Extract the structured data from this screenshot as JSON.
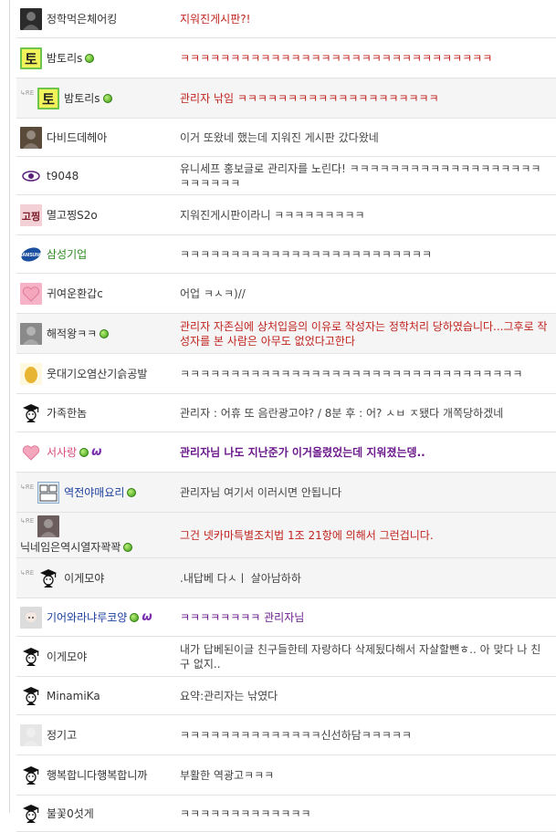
{
  "comments": [
    {
      "nick": "정학먹은체어킹",
      "text": "지워진게시판?!",
      "style": "red",
      "avatar": "photo-icon",
      "avatar_color": "#2b2b2b"
    },
    {
      "nick": "밤토리s",
      "text": "ㅋㅋㅋㅋㅋㅋㅋㅋㅋㅋㅋㅋㅋㅋㅋㅋㅋㅋㅋㅋㅋㅋㅋㅋㅋㅋㅋㅋㅋㅋㅋ",
      "style": "red",
      "avatar": "to-character-icon",
      "avatar_text": "토",
      "avatar_color": "#6fc44b",
      "online": true
    },
    {
      "nick": "밤토리s",
      "text": "관리자 낚임 ㅋㅋㅋㅋㅋㅋㅋㅋㅋㅋㅋㅋㅋㅋㅋㅋㅋㅋㅋㅋ",
      "style": "red",
      "avatar": "to-character-icon",
      "avatar_text": "토",
      "avatar_color": "#6fc44b",
      "online": true,
      "reply": true
    },
    {
      "nick": "다비드데헤아",
      "text": "이거 또왔네 했는데 지워진 게시판 갔다왔네",
      "style": "gray",
      "avatar": "photo-icon",
      "avatar_color": "#5a4a3a"
    },
    {
      "nick": "t9048",
      "text": "유니세프 홍보글로 관리자를 노린다! ㅋㅋㅋㅋㅋㅋㅋㅋㅋㅋㅋㅋㅋㅋㅋㅋㅋㅋㅋㅋㅋㅋㅋㅋㅋ",
      "style": "gray",
      "avatar": "eye-icon",
      "avatar_color": "#ffffff"
    },
    {
      "nick": "멸고찡S2o",
      "text": "지워진게시판이라니 ㅋㅋㅋㅋㅋㅋㅋㅋㅋ",
      "style": "gray",
      "avatar": "text-logo-icon",
      "avatar_text": "고찡",
      "avatar_color": "#7a1c2a"
    },
    {
      "nick": "삼성기업",
      "text": "ㅋㅋㅋㅋㅋㅋㅋㅋㅋㅋㅋㅋㅋㅋㅋㅋㅋㅋㅋㅋㅋㅋㅋㅋㅋ",
      "style": "gray",
      "avatar": "samsung-logo-icon",
      "avatar_color": "#1b4fa0",
      "name_color": "green"
    },
    {
      "nick": "귀여운환갑c",
      "text": "어업 ㅋㅅㅋ)//",
      "style": "gray",
      "avatar": "heart-icon",
      "avatar_color": "#f6b3c8"
    },
    {
      "nick": "해적왕ㅋㅋ",
      "text": "관리자 자존심에 상처입음의 이유로 작성자는 정학처리 당하였습니다...그후로 작성자를 본 사람은 아무도 없었다고한다",
      "style": "red",
      "avatar": "photo-icon",
      "avatar_color": "#8a8a8a",
      "online": true
    },
    {
      "nick": "웃대기오염산기슭공발",
      "text": "ㅋㅋㅋㅋㅋㅋㅋㅋㅋㅋㅋㅋㅋㅋㅋㅋㅋㅋㅋㅋㅋㅋㅋㅋㅋㅋㅋㅋㅋㅋㅋㅋㅋㅋ",
      "style": "gray",
      "avatar": "egg-icon",
      "avatar_color": "#e8b532"
    },
    {
      "nick": "가족한놈",
      "text": "관리자 : 어휴 또 음란광고야? / 8분 후 : 어? ㅅㅂ ㅈ됐다 개쪽당하겠네",
      "style": "gray",
      "avatar": "graduate-icon",
      "avatar_color": "#ffffff"
    },
    {
      "nick": "서사랑",
      "text": "관리자님 나도 지난준가 이거올렸었는데 지워졌는뎅..",
      "style": "purple",
      "avatar": "heart-icon",
      "avatar_color": "#ffffff",
      "online": true,
      "w_badge": "ω",
      "name_color": "pink"
    },
    {
      "nick": "역전야매요리",
      "text": "관리자님 여기서 이러시면 안됩니다",
      "style": "gray",
      "avatar": "comic-icon",
      "avatar_color": "#dfe9f3",
      "online": true,
      "reply": true,
      "name_color": "blue"
    },
    {
      "nick": "닉네임은역시열자꽉꽉",
      "text": "그건 넷카마특별조치법 1조 21항에 의해서 그런겁니다.",
      "style": "red",
      "avatar": "photo-icon",
      "avatar_color": "#6b5d5d",
      "online": true,
      "reply": true,
      "stacked": true
    },
    {
      "nick": "이게모야",
      "text": ".내답베 다ㅅㅣ 살아남하하",
      "style": "gray",
      "avatar": "graduate-icon",
      "avatar_color": "#ffffff",
      "reply": true
    },
    {
      "nick": "기어와라냐루코양",
      "text": "ㅋㅋㅋㅋㅋㅋㅋㅋ 관리자님",
      "style": "purple-plain",
      "avatar": "anime-icon",
      "avatar_color": "#dcdcdc",
      "online": true,
      "w_badge": "ω",
      "name_color": "blue"
    },
    {
      "nick": "이게모야",
      "text": "내가 답베된이글 친구들한테 자랑하다 삭제됬다해서 자살할뺀ㅎ.. 아 맞다 나 친구 없지..",
      "style": "gray",
      "avatar": "graduate-icon",
      "avatar_color": "#ffffff"
    },
    {
      "nick": "MinamiKa",
      "text": "요약:관리자는 낚였다",
      "style": "gray",
      "avatar": "graduate-icon",
      "avatar_color": "#ffffff"
    },
    {
      "nick": "정기고",
      "text": "ㅋㅋㅋㅋㅋㅋㅋㅋㅋㅋㅋㅋㅋㅋ신선하담ㅋㅋㅋㅋㅋ",
      "style": "gray",
      "avatar": "photo-icon",
      "avatar_color": "#e6e6e6"
    },
    {
      "nick": "행복합니다행복합니까",
      "text": "부활한 역광고ㅋㅋㅋ",
      "style": "gray",
      "avatar": "graduate-icon",
      "avatar_color": "#ffffff"
    },
    {
      "nick": "불꽃0섯게",
      "text": "ㅋㅋㅋㅋㅋㅋㅋㅋㅋㅋㅋㅋㅋ",
      "style": "gray",
      "avatar": "graduate-icon",
      "avatar_color": "#ffffff"
    }
  ],
  "reply_marker": "RE"
}
